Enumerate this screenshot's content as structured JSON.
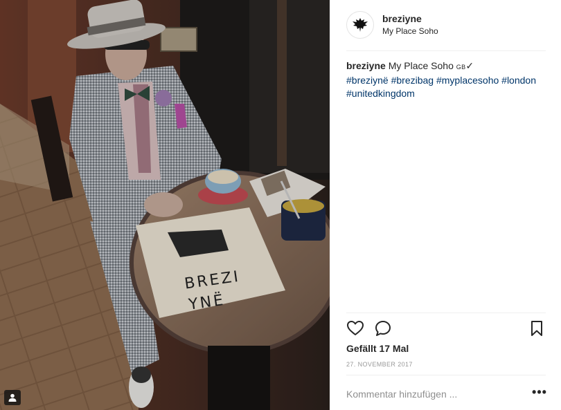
{
  "post": {
    "username": "breziyne",
    "location": "My Place Soho",
    "caption": {
      "username": "breziyne",
      "text": "My Place Soho",
      "flag": "GB",
      "check": "✓",
      "hashtags": [
        "#breziynë",
        "#brezibag",
        "#myplacesoho",
        "#london",
        "#unitedkingdom"
      ]
    },
    "likes": "Gefällt 17 Mal",
    "date": "27. NOVEMBER 2017",
    "comment_placeholder": "Kommentar hinzufügen ...",
    "more_label": "•••"
  },
  "photo": {
    "bag_text_line1": "BREZI",
    "bag_text_line2": "YNË"
  },
  "icons": {
    "avatar": "eagle-logo-icon",
    "like": "heart-icon",
    "comment": "comment-bubble-icon",
    "save": "bookmark-icon",
    "tagged": "user-tag-icon"
  },
  "colors": {
    "hashtag": "#003569",
    "text": "#262626",
    "muted": "#999999",
    "divider": "#efefef"
  }
}
